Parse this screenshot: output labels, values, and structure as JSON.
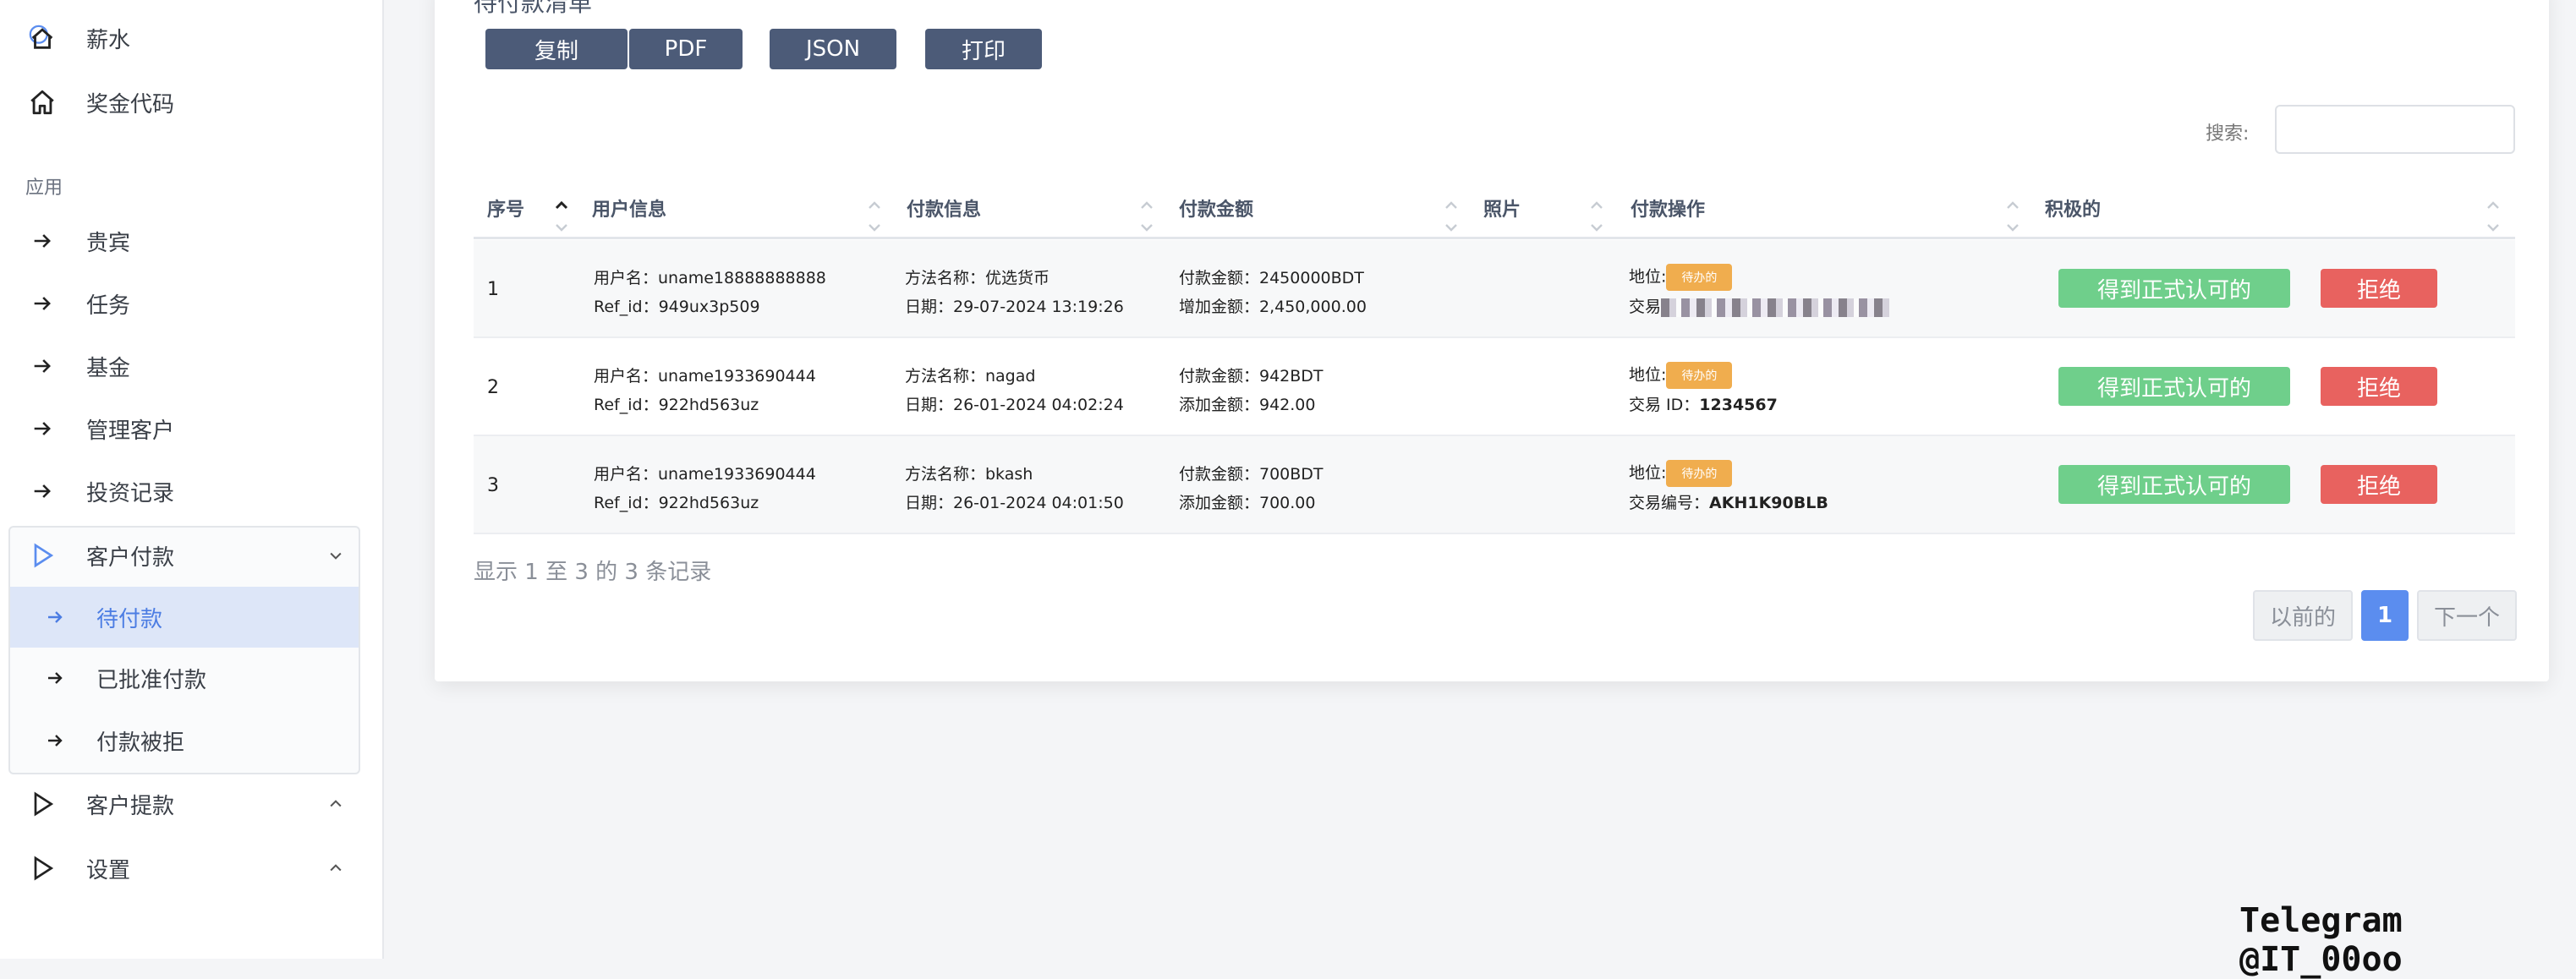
{
  "sidebar": {
    "top_items": [
      {
        "label": "薪水",
        "icon": "home-icon"
      },
      {
        "label": "奖金代码",
        "icon": "home-icon"
      }
    ],
    "section_label": "应用",
    "app_items": [
      {
        "label": "贵宾"
      },
      {
        "label": "任务"
      },
      {
        "label": "基金"
      },
      {
        "label": "管理客户"
      },
      {
        "label": "投资记录"
      }
    ],
    "customer_payment": {
      "label": "客户付款",
      "sub_items": [
        {
          "label": "待付款",
          "active": true
        },
        {
          "label": "已批准付款"
        },
        {
          "label": "付款被拒"
        }
      ]
    },
    "withdraw": {
      "label": "客户提款"
    },
    "settings": {
      "label": "设置"
    }
  },
  "card": {
    "title": "待付款清单",
    "buttons": [
      "复制",
      "PDF",
      "JSON",
      "打印"
    ],
    "search_label": "搜索:"
  },
  "table": {
    "headers": [
      "序号",
      "用户信息",
      "付款信息",
      "付款金额",
      "照片",
      "付款操作",
      "积极的"
    ],
    "rows": [
      {
        "num": "1",
        "user": "用户名：uname18888888888",
        "ref": "Ref_id：949ux3p509",
        "method": "方法名称：优选货币",
        "date": "日期：29-07-2024 13:19:26",
        "amount": "付款金额：2450000BDT",
        "added": "增加金额：2,450,000.00",
        "status_label": "地位:",
        "status": "待办的",
        "txn_label": "交易",
        "txn_value": "",
        "approve": "得到正式认可的",
        "reject": "拒绝"
      },
      {
        "num": "2",
        "user": "用户名：uname1933690444",
        "ref": "Ref_id：922hd563uz",
        "method": "方法名称：nagad",
        "date": "日期：26-01-2024 04:02:24",
        "amount": "付款金额：942BDT",
        "added": "添加金额：942.00",
        "status_label": "地位:",
        "status": "待办的",
        "txn_label": "交易 ID：",
        "txn_value": "1234567",
        "approve": "得到正式认可的",
        "reject": "拒绝"
      },
      {
        "num": "3",
        "user": "用户名：uname1933690444",
        "ref": "Ref_id：922hd563uz",
        "method": "方法名称：bkash",
        "date": "日期：26-01-2024 04:01:50",
        "amount": "付款金额：700BDT",
        "added": "添加金额：700.00",
        "status_label": "地位:",
        "status": "待办的",
        "txn_label": "交易编号：",
        "txn_value": "AKH1K90BLB",
        "approve": "得到正式认可的",
        "reject": "拒绝"
      }
    ]
  },
  "footer": {
    "info": "显示 1 至 3 的 3 条记录",
    "prev": "以前的",
    "page": "1",
    "next": "下一个"
  },
  "watermark": "Telegram @IT_00oo",
  "colors": {
    "accent": "#5b8def",
    "approve": "#6fcf8b",
    "reject": "#e8625f",
    "pending": "#f0ad4e",
    "export_button": "#4c5b78"
  }
}
